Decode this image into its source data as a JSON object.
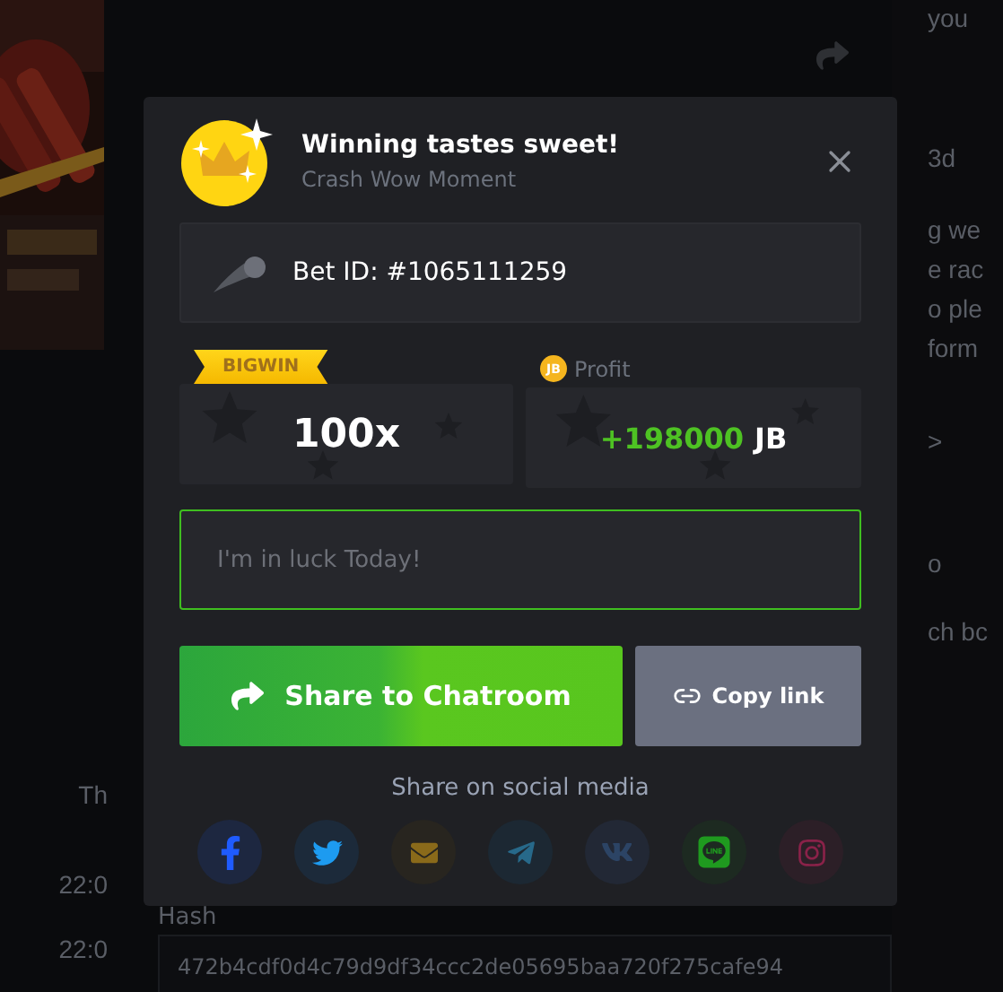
{
  "background": {
    "right_texts": [
      "you",
      "3d",
      "g we",
      "e rac",
      "o ple",
      "form",
      ">",
      "o",
      "ch bc"
    ],
    "left_texts": [
      "Th",
      "22:0",
      "22:0"
    ],
    "hash_label": "Hash",
    "hash_value": "472b4cdf0d4c79d9df34ccc2de05695baa720f275cafe94"
  },
  "modal": {
    "title": "Winning tastes sweet!",
    "subtitle": "Crash Wow Moment",
    "bet_id": "Bet ID: #1065111259",
    "badge": "BIGWIN",
    "multiplier": "100x",
    "coin": "JB",
    "profit_label": "Profit",
    "profit_amount": "+198000",
    "profit_currency": "JB",
    "message": {
      "placeholder": "I'm in luck Today!"
    },
    "buttons": [
      {
        "kind": "share",
        "label": "Share to Chatroom"
      },
      {
        "kind": "copy",
        "label": "Copy link"
      }
    ],
    "social_title": "Share on social media",
    "social": [
      {
        "kind": "facebook"
      },
      {
        "kind": "twitter"
      },
      {
        "kind": "mail"
      },
      {
        "kind": "telegram"
      },
      {
        "kind": "vk"
      },
      {
        "kind": "line"
      },
      {
        "kind": "instagram"
      }
    ]
  }
}
